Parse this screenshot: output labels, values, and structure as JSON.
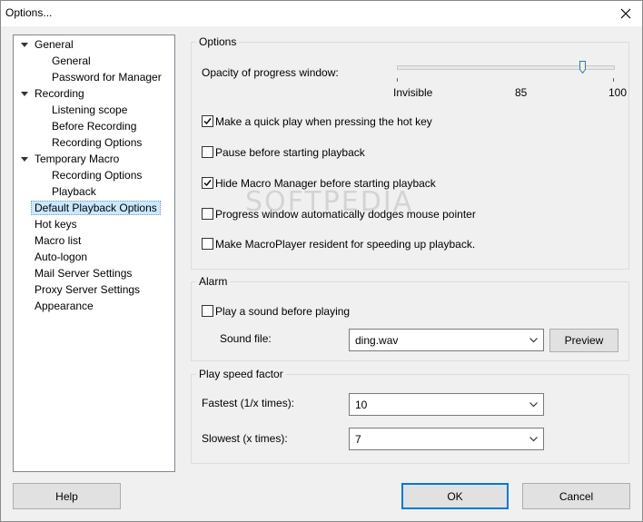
{
  "window": {
    "title": "Options..."
  },
  "tree": {
    "items": [
      {
        "label": "General",
        "level": 0,
        "expanded": true
      },
      {
        "label": "General",
        "level": 1
      },
      {
        "label": "Password for Manager",
        "level": 1
      },
      {
        "label": "Recording",
        "level": 0,
        "expanded": true
      },
      {
        "label": "Listening scope",
        "level": 1
      },
      {
        "label": "Before Recording",
        "level": 1
      },
      {
        "label": "Recording Options",
        "level": 1
      },
      {
        "label": "Temporary Macro",
        "level": 0,
        "expanded": true
      },
      {
        "label": "Recording Options",
        "level": 1
      },
      {
        "label": "Playback",
        "level": 1
      },
      {
        "label": "Default Playback Options",
        "level": 0,
        "selected": true
      },
      {
        "label": "Hot keys",
        "level": 0
      },
      {
        "label": "Macro list",
        "level": 0
      },
      {
        "label": "Auto-logon",
        "level": 0
      },
      {
        "label": "Mail Server Settings",
        "level": 0
      },
      {
        "label": "Proxy Server Settings",
        "level": 0
      },
      {
        "label": "Appearance",
        "level": 0
      }
    ]
  },
  "options": {
    "title": "Options",
    "opacity_label": "Opacity of progress window:",
    "opacity_value": 85,
    "opacity_min_label": "Invisible",
    "opacity_mid_label": "85",
    "opacity_max_label": "100",
    "checkboxes": [
      {
        "label": "Make a quick play when pressing the hot key",
        "checked": true
      },
      {
        "label": "Pause before starting playback",
        "checked": false
      },
      {
        "label": "Hide Macro Manager before starting playback",
        "checked": true
      },
      {
        "label": "Progress window automatically dodges mouse pointer",
        "checked": false
      },
      {
        "label": "Make MacroPlayer resident for speeding up playback.",
        "checked": false
      }
    ]
  },
  "alarm": {
    "title": "Alarm",
    "play_sound_label": "Play a sound before playing",
    "play_sound_checked": false,
    "sound_file_label": "Sound file:",
    "sound_file_value": "ding.wav",
    "preview_label": "Preview"
  },
  "speed": {
    "title": "Play speed factor",
    "fastest_label": "Fastest (1/x times):",
    "fastest_value": "10",
    "slowest_label": "Slowest (x times):",
    "slowest_value": "7"
  },
  "buttons": {
    "help": "Help",
    "ok": "OK",
    "cancel": "Cancel"
  },
  "watermark": "SOFTPEDIA"
}
